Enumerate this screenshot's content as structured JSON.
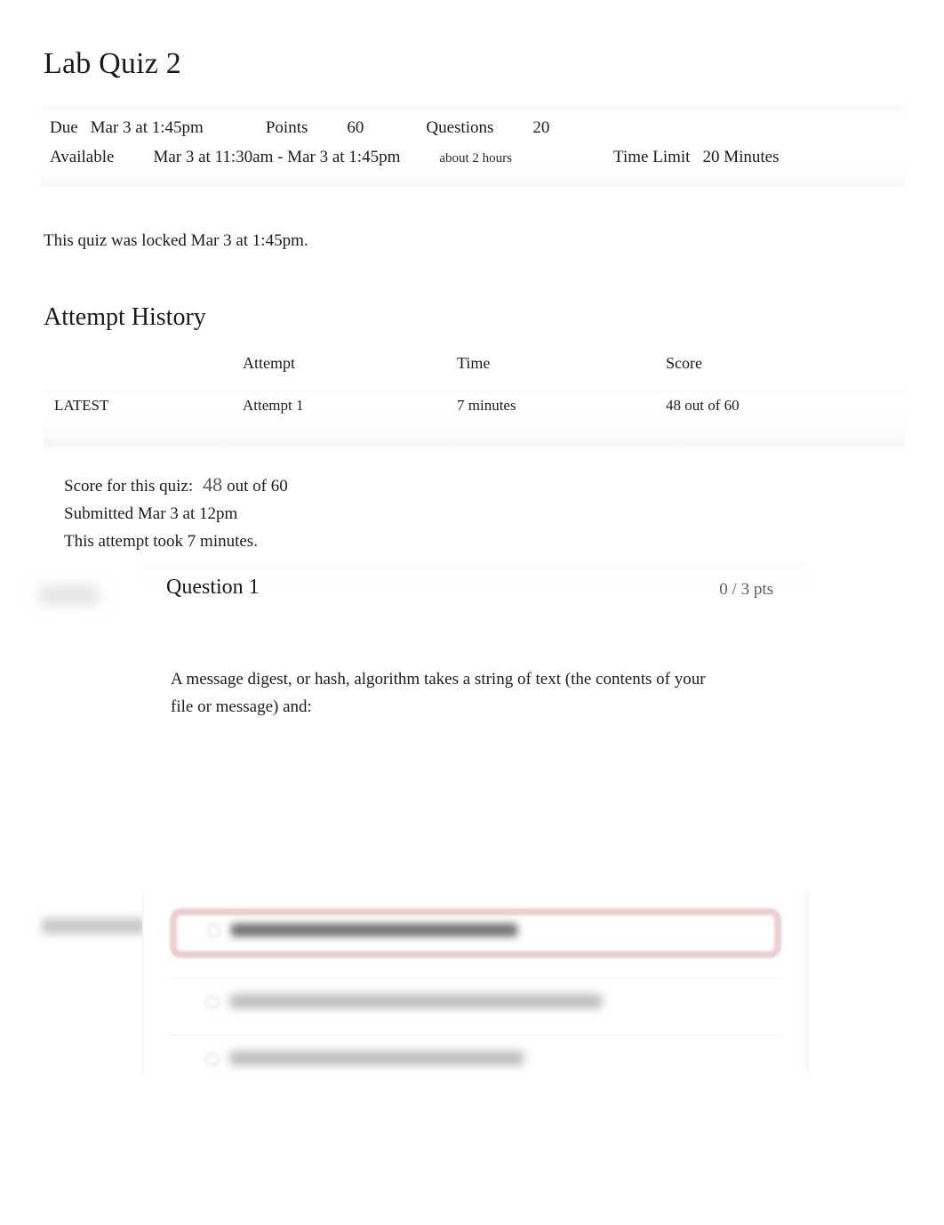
{
  "page": {
    "title": "Lab Quiz 2"
  },
  "quiz_header": {
    "due_label": "Due",
    "due_value": "Mar 3 at 1:45pm",
    "points_label": "Points",
    "points_value": "60",
    "questions_label": "Questions",
    "questions_value": "20",
    "available_label": "Available",
    "available_value": "Mar 3 at 11:30am - Mar 3 at 1:45pm",
    "duration_note": "about 2 hours",
    "time_limit_label": "Time Limit",
    "time_limit_value": "20 Minutes"
  },
  "locked_notice": "This quiz was locked Mar 3 at 1:45pm.",
  "attempt_history": {
    "heading": "Attempt History",
    "columns": {
      "kept": "",
      "attempt": "Attempt",
      "time": "Time",
      "score": "Score"
    },
    "rows": [
      {
        "kept": "LATEST",
        "attempt": "Attempt 1",
        "time": "7 minutes",
        "score": "48 out of 60"
      }
    ]
  },
  "score_summary": {
    "score_label": "Score for this quiz:",
    "score_value": "48",
    "score_out_of": "out of 60",
    "submitted": "Submitted Mar 3 at 12pm",
    "duration": "This attempt took 7 minutes."
  },
  "question": {
    "title": "Question 1",
    "points": "0 / 3 pts",
    "text": "A message digest, or hash, algorithm takes a string of text (the contents of your file or message) and:",
    "answers": [
      {
        "id": "answer-1",
        "text": "",
        "state": "selected-incorrect"
      },
      {
        "id": "answer-2",
        "text": "",
        "state": "default"
      },
      {
        "id": "answer-3",
        "text": "",
        "state": "default"
      }
    ]
  },
  "colors": {
    "link": "#2f5fbf",
    "incorrect_border": "#eccfcf",
    "muted_text": "#5d5d5d"
  }
}
